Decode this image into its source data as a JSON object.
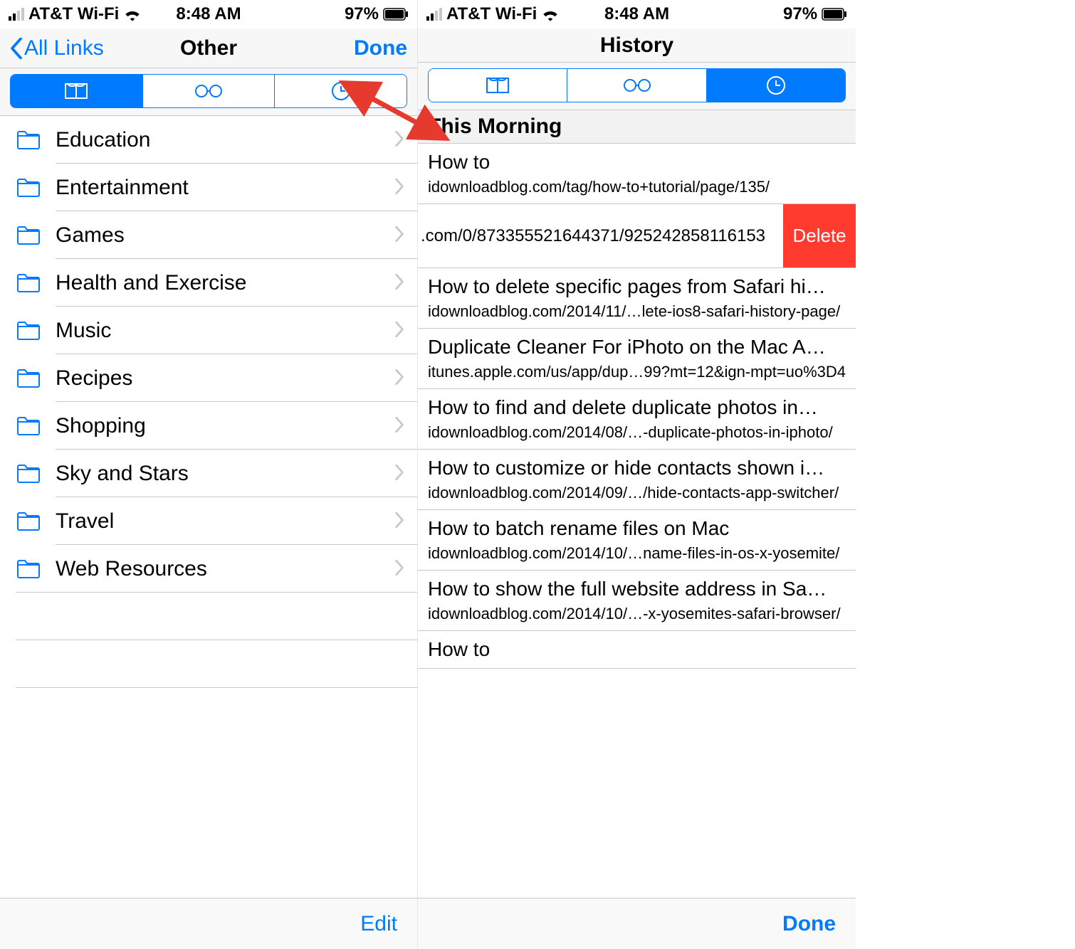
{
  "status": {
    "carrier": "AT&T Wi-Fi",
    "time": "8:48 AM",
    "battery": "97%"
  },
  "left": {
    "back_label": "All Links",
    "title": "Other",
    "done_label": "Done",
    "folders": [
      "Education",
      "Entertainment",
      "Games",
      "Health and Exercise",
      "Music",
      "Recipes",
      "Shopping",
      "Sky and Stars",
      "Travel",
      "Web Resources"
    ],
    "toolbar_button": "Edit"
  },
  "right": {
    "title": "History",
    "section": "This Morning",
    "items": [
      {
        "title": "How to",
        "url": "idownloadblog.com/tag/how-to+tutorial/page/135/"
      },
      {
        "swiped": true,
        "url": ".com/0/873355521644371/925242858116153",
        "delete_label": "Delete"
      },
      {
        "title": "How to delete specific pages from Safari hi…",
        "url": "idownloadblog.com/2014/11/…lete-ios8-safari-history-page/"
      },
      {
        "title": "Duplicate Cleaner For iPhoto on the Mac A…",
        "url": "itunes.apple.com/us/app/dup…99?mt=12&ign-mpt=uo%3D4"
      },
      {
        "title": "How to find and delete duplicate photos in…",
        "url": "idownloadblog.com/2014/08/…-duplicate-photos-in-iphoto/"
      },
      {
        "title": "How to customize or hide contacts shown i…",
        "url": "idownloadblog.com/2014/09/…/hide-contacts-app-switcher/"
      },
      {
        "title": "How to batch rename files on Mac",
        "url": "idownloadblog.com/2014/10/…name-files-in-os-x-yosemite/"
      },
      {
        "title": "How to show the full website address in Sa…",
        "url": "idownloadblog.com/2014/10/…-x-yosemites-safari-browser/"
      },
      {
        "title": "How to",
        "url": ""
      }
    ],
    "toolbar_button": "Done"
  }
}
